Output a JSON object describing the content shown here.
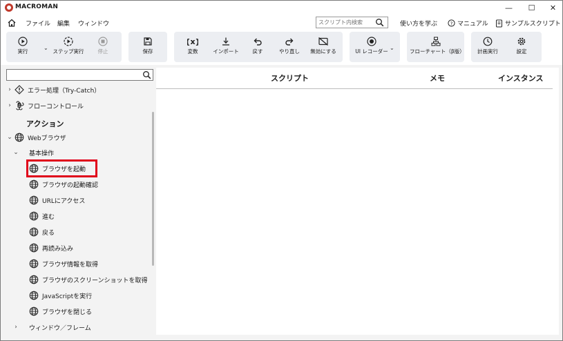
{
  "window": {
    "title": "MACROMAN",
    "controls": {
      "minimize": "—",
      "maximize": "☐",
      "close": "✕"
    }
  },
  "menubar": {
    "menus": [
      "ファイル",
      "編集",
      "ウィンドウ"
    ],
    "search": {
      "placeholder": "スクリプト内検索",
      "value": ""
    },
    "links": {
      "how_to": "使い方を学ぶ",
      "manual": "マニュアル",
      "samples": "サンプルスクリプト"
    }
  },
  "toolbar": {
    "run": "実行",
    "step_run": "ステップ実行",
    "stop": "停止",
    "save": "保存",
    "variable": "変数",
    "import": "インポート",
    "undo": "戻す",
    "redo": "やり直し",
    "disable": "無効にする",
    "ui_recorder": "UI レコーダー",
    "flowchart": "フローチャート（β版）",
    "schedule": "計画実行",
    "settings": "設定"
  },
  "leftpanel": {
    "search": {
      "placeholder": "",
      "value": ""
    },
    "tree": {
      "error_handling": "エラー処理（Try-Catch）",
      "flow_control": "フローコントロール",
      "actions_title": "アクション",
      "web_browser": "Webブラウザ",
      "basic_ops": "基本操作",
      "items": [
        "ブラウザを起動",
        "ブラウザの起動確認",
        "URLにアクセス",
        "進む",
        "戻る",
        "再読み込み",
        "ブラウザ情報を取得",
        "ブラウザのスクリーンショットを取得",
        "JavaScriptを実行",
        "ブラウザを閉じる"
      ],
      "window_frame": "ウィンドウ／フレーム"
    }
  },
  "mainpanel": {
    "columns": {
      "script": "スクリプト",
      "memo": "メモ",
      "instance": "インスタンス"
    }
  },
  "colors": {
    "highlight": "#e0001a",
    "toolbar_group_bg": "#eceef2"
  }
}
